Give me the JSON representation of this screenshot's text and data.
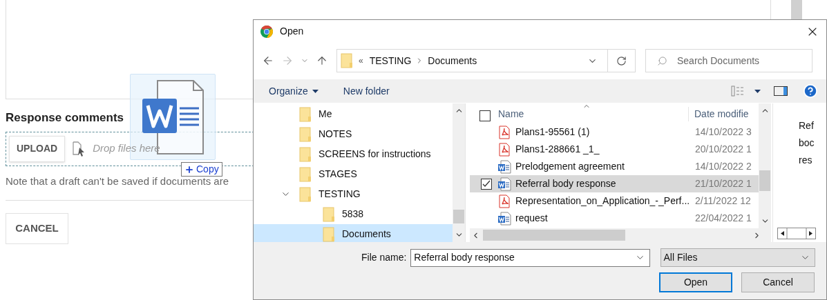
{
  "page": {
    "section_title": "Response comments",
    "upload_button": "UPLOAD",
    "drop_hint": "Drop files here",
    "note": "Note that a draft can't be saved if documents are",
    "cancel_button": "CANCEL"
  },
  "drag": {
    "badge": "Copy"
  },
  "dialog": {
    "title": "Open",
    "overflow_marker": "«",
    "breadcrumb": [
      "TESTING",
      "Documents"
    ],
    "search_placeholder": "Search Documents",
    "toolbar": {
      "organize": "Organize",
      "new_folder": "New folder"
    },
    "tree": [
      {
        "label": "Me",
        "selected": false,
        "expanded": false
      },
      {
        "label": "NOTES",
        "selected": false,
        "expanded": false
      },
      {
        "label": "SCREENS for instructions",
        "selected": false,
        "expanded": false
      },
      {
        "label": "STAGES",
        "selected": false,
        "expanded": false
      },
      {
        "label": "TESTING",
        "selected": false,
        "expanded": true,
        "children": [
          {
            "label": "5838",
            "selected": false
          },
          {
            "label": "Documents",
            "selected": true
          }
        ]
      }
    ],
    "columns": [
      "Name",
      "Date modifie"
    ],
    "header_checked": false,
    "files": [
      {
        "kind": "pdf",
        "name": "Plans1-95561 (1)",
        "date": "14/10/2022 3",
        "selected": false,
        "checked": false
      },
      {
        "kind": "pdf",
        "name": "Plans1-288661 _1_",
        "date": "20/10/2022 1",
        "selected": false,
        "checked": false
      },
      {
        "kind": "word",
        "name": "Prelodgement agreement",
        "date": "14/10/2022 2",
        "selected": false,
        "checked": false
      },
      {
        "kind": "word",
        "name": "Referral body response",
        "date": "21/10/2022 1",
        "selected": true,
        "checked": true
      },
      {
        "kind": "pdf",
        "name": "Representation_on_Application_-_Perf...",
        "date": "2/11/2022 12",
        "selected": false,
        "checked": false
      },
      {
        "kind": "word",
        "name": "request",
        "date": "22/04/2022 1",
        "selected": false,
        "checked": false
      }
    ],
    "preview_lines": [
      "Ref",
      "boc",
      "res"
    ],
    "file_name_label": "File name:",
    "file_name": "Referral body response",
    "filter": "All Files",
    "buttons": [
      {
        "label": "Open",
        "default": true
      },
      {
        "label": "Cancel",
        "default": false
      }
    ]
  }
}
